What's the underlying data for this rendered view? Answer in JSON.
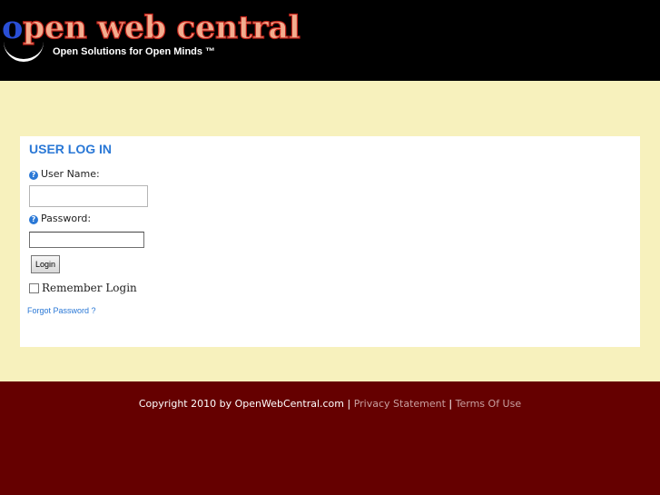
{
  "header": {
    "logo_first_letter": "o",
    "logo_rest": "pen web central",
    "tagline": "Open Solutions for Open Minds ™"
  },
  "login": {
    "title": "USER LOG IN",
    "help_glyph": "?",
    "username_label": "User Name:",
    "username_value": "",
    "password_label": "Password:",
    "password_value": "",
    "login_button": "Login",
    "remember_label": "Remember Login",
    "remember_checked": false,
    "forgot_link": "Forgot Password ?"
  },
  "footer": {
    "copyright": "Copyright 2010 by OpenWebCentral.com",
    "separator": " | ",
    "privacy_link": "Privacy Statement",
    "terms_link": "Terms Of Use"
  },
  "colors": {
    "header_bg": "#000000",
    "body_bg": "#f7f1bd",
    "panel_bg": "#ffffff",
    "accent_blue": "#2a78d6",
    "footer_bg": "#650000"
  }
}
